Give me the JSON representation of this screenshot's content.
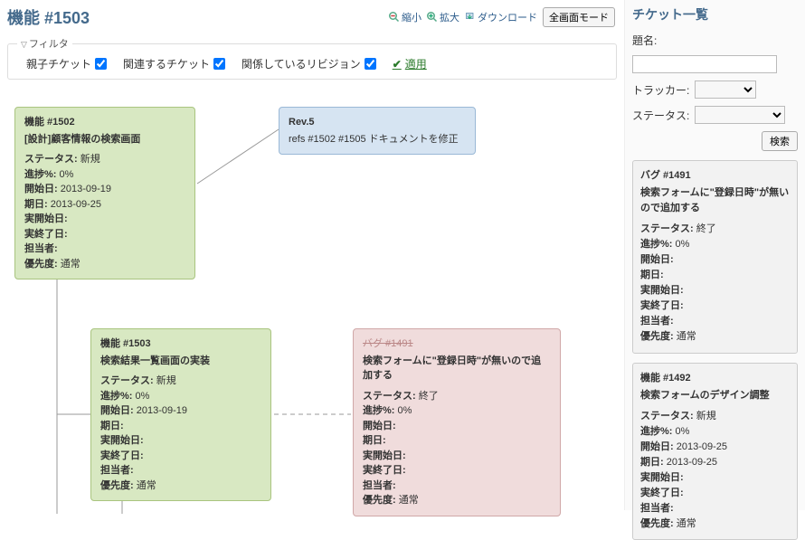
{
  "title": "機能 #1503",
  "toolbar": {
    "zoom_out": "縮小",
    "zoom_in": "拡大",
    "download": "ダウンロード",
    "fullscreen": "全画面モード"
  },
  "filters": {
    "legend": "フィルタ",
    "parent_child": "親子チケット",
    "related": "関連するチケット",
    "revisions": "関係しているリビジョン",
    "apply": "適用"
  },
  "field_labels": {
    "status": "ステータス:",
    "progress": "進捗%:",
    "start": "開始日:",
    "due": "期日:",
    "actual_start": "実開始日:",
    "actual_end": "実終了日:",
    "assignee": "担当者:",
    "priority": "優先度:"
  },
  "nodes": {
    "n1502": {
      "head": "機能 #1502",
      "sub": "[設計]顧客情報の検索画面",
      "status": "新規",
      "progress": "0%",
      "start": "2013-09-19",
      "due": "2013-09-25",
      "actual_start": "",
      "actual_end": "",
      "assignee": "",
      "priority": "通常"
    },
    "rev5": {
      "head": "Rev.5",
      "sub": "refs #1502 #1505 ドキュメントを修正"
    },
    "n1503": {
      "head": "機能 #1503",
      "sub": "検索結果一覧画面の実装",
      "status": "新規",
      "progress": "0%",
      "start": "2013-09-19",
      "due": "",
      "actual_start": "",
      "actual_end": "",
      "assignee": "",
      "priority": "通常"
    },
    "n1491": {
      "head": "バグ #1491",
      "sub": "検索フォームに\"登録日時\"が無いので追加する",
      "status": "終了",
      "progress": "0%",
      "start": "",
      "due": "",
      "actual_start": "",
      "actual_end": "",
      "assignee": "",
      "priority": "通常"
    }
  },
  "sidebar": {
    "heading": "チケット一覧",
    "subject_label": "題名:",
    "tracker_label": "トラッカー:",
    "status_label": "ステータス:",
    "search_btn": "検索",
    "cards": {
      "c1491": {
        "head": "バグ #1491",
        "sub": "検索フォームに\"登録日時\"が無いので追加する",
        "status": "終了",
        "progress": "0%",
        "start": "",
        "due": "",
        "actual_start": "",
        "actual_end": "",
        "assignee": "",
        "priority": "通常"
      },
      "c1492": {
        "head": "機能 #1492",
        "sub": "検索フォームのデザイン調整",
        "status": "新規",
        "progress": "0%",
        "start": "2013-09-25",
        "due": "2013-09-25",
        "actual_start": "",
        "actual_end": "",
        "assignee": "",
        "priority": "通常"
      }
    }
  }
}
